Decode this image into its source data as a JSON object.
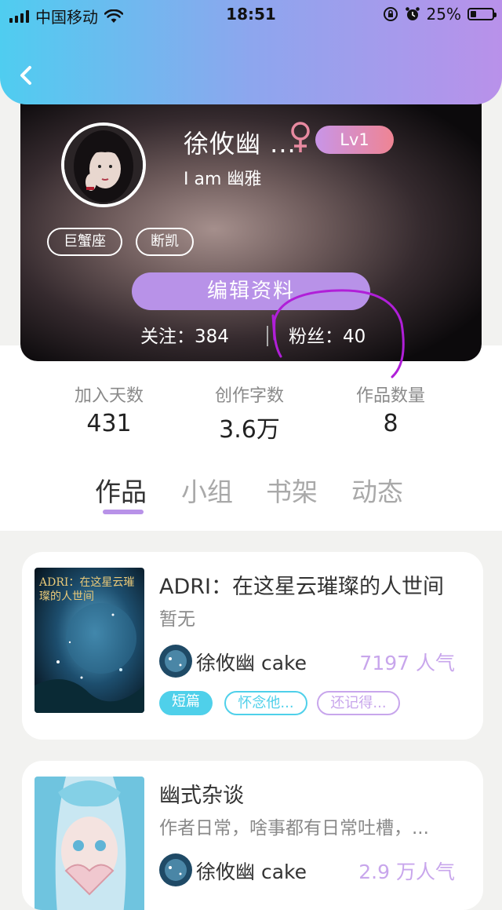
{
  "status_bar": {
    "carrier": "中国移动",
    "time": "18:51",
    "battery": "25%"
  },
  "profile": {
    "name": "徐攸幽 ...",
    "gender_icon": "female-symbol-icon",
    "level": "Lv1",
    "bio": "I am 幽雅",
    "tags": [
      "巨蟹座",
      "断凯"
    ],
    "edit_button": "编辑资料",
    "following_label": "关注：",
    "following_value": "384",
    "fans_label": "粉丝：",
    "fans_value": "40"
  },
  "stats": [
    {
      "label": "加入天数",
      "value": "431"
    },
    {
      "label": "创作字数",
      "value": "3.6万"
    },
    {
      "label": "作品数量",
      "value": "8"
    }
  ],
  "tabs": [
    "作品",
    "小组",
    "书架",
    "动态"
  ],
  "works": [
    {
      "title": "ADRI：在这星云璀璨的人世间",
      "cover_text": "ADRI：在这星云璀璨的人世间",
      "description": "暂无",
      "author": "徐攸幽 cake",
      "popularity": "7197 人气",
      "tags": [
        "短篇",
        "怀念他...",
        "还记得..."
      ]
    },
    {
      "title": "幽式杂谈",
      "description": "作者日常，啥事都有日常吐槽，...",
      "author": "徐攸幽 cake",
      "popularity": "2.9 万人气"
    }
  ],
  "colors": {
    "header_start": "#4fcdf0",
    "header_end": "#b991ea",
    "accent_purple": "#b892e8",
    "chip_cyan": "#4fd0ea",
    "chip_purple": "#c8a6ec",
    "annotation": "#b01fd8"
  }
}
